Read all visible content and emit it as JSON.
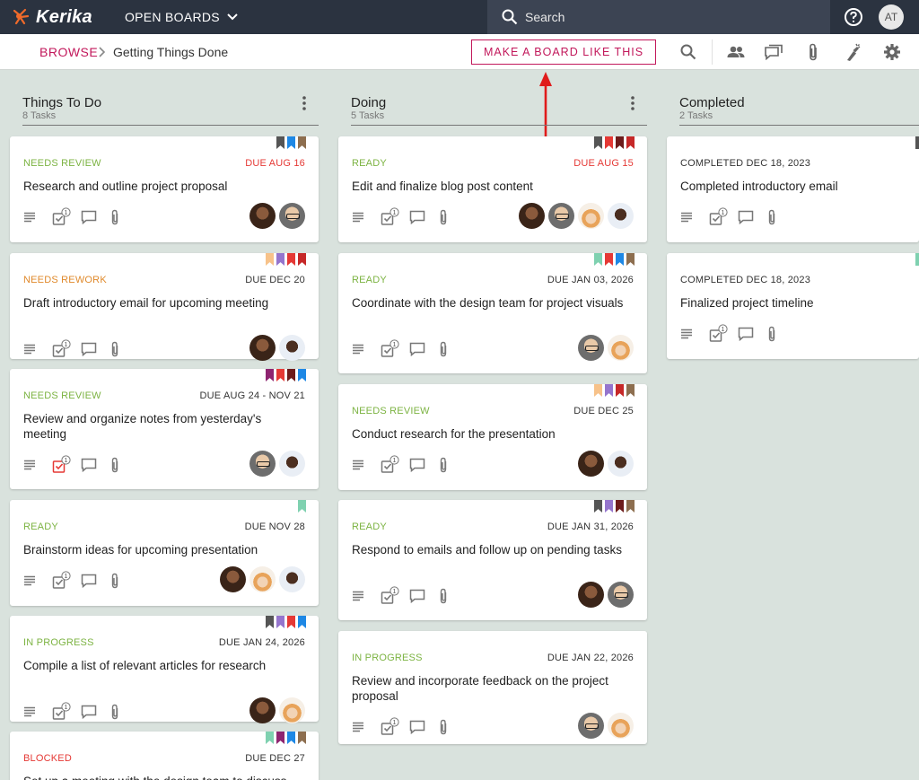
{
  "topbar": {
    "logo_text": "Kerika",
    "open_boards_label": "OPEN BOARDS",
    "search_placeholder": "Search",
    "user_initials": "AT"
  },
  "subbar": {
    "breadcrumb_root": "BROWSE",
    "breadcrumb_current": "Getting Things Done",
    "make_board_label": "MAKE A BOARD LIKE THIS"
  },
  "colors": {
    "topbar_bg": "#2b3340",
    "accent": "#c2185b",
    "board_bg": "#d9e2dd",
    "status_green": "#7cb342",
    "status_orange": "#e08a2c",
    "status_red": "#e53935",
    "due_red": "#e53935"
  },
  "columns": [
    {
      "title": "Things To Do",
      "count": "8 Tasks",
      "cards": [
        {
          "status": "NEEDS REVIEW",
          "status_color": "#7cb342",
          "due": "DUE AUG 16",
          "due_color": "#e53935",
          "title": "Research and outline project proposal",
          "flags": [
            "#555555",
            "#1e88e5",
            "#8d6e4f"
          ],
          "avatars": [
            "dark",
            "glasses"
          ],
          "check_red": false
        },
        {
          "status": "NEEDS REWORK",
          "status_color": "#e08a2c",
          "due": "DUE DEC 20",
          "due_color": "#333333",
          "title": "Draft introductory email for upcoming meeting",
          "flags": [
            "#f7c28a",
            "#9575cd",
            "#e53935",
            "#c62828"
          ],
          "avatars": [
            "dark",
            "woman"
          ],
          "check_red": false
        },
        {
          "status": "NEEDS REVIEW",
          "status_color": "#7cb342",
          "due": "DUE AUG 24 - NOV 21",
          "due_color": "#333333",
          "title": "Review and organize notes from yesterday's meeting",
          "flags": [
            "#8e2470",
            "#e53935",
            "#6d1b1b",
            "#1e88e5"
          ],
          "avatars": [
            "glasses",
            "woman"
          ],
          "check_red": true
        },
        {
          "status": "READY",
          "status_color": "#7cb342",
          "due": "DUE NOV 28",
          "due_color": "#333333",
          "title": "Brainstorm ideas for upcoming presentation",
          "flags": [
            "#7fd1b0"
          ],
          "avatars": [
            "dark",
            "hat",
            "woman"
          ],
          "check_red": false
        },
        {
          "status": "IN PROGRESS",
          "status_color": "#7cb342",
          "due": "DUE JAN 24, 2026",
          "due_color": "#333333",
          "title": "Compile a list of relevant articles for research",
          "flags": [
            "#555555",
            "#9575cd",
            "#e53935",
            "#1e88e5"
          ],
          "avatars": [
            "dark",
            "hat"
          ],
          "check_red": false
        },
        {
          "status": "BLOCKED",
          "status_color": "#e53935",
          "due": "DUE DEC 27",
          "due_color": "#333333",
          "title": "Set up a meeting with the design team to discuss",
          "flags": [
            "#7fd1b0",
            "#8e2470",
            "#1e88e5",
            "#8d6e4f"
          ],
          "avatars": [],
          "check_red": false
        }
      ]
    },
    {
      "title": "Doing",
      "count": "5 Tasks",
      "cards": [
        {
          "status": "READY",
          "status_color": "#7cb342",
          "due": "DUE AUG 15",
          "due_color": "#e53935",
          "title": "Edit and finalize blog post content",
          "flags": [
            "#555555",
            "#e53935",
            "#6d1b1b",
            "#c62828"
          ],
          "avatars": [
            "dark",
            "glasses",
            "hat",
            "woman"
          ],
          "check_red": false
        },
        {
          "status": "READY",
          "status_color": "#7cb342",
          "due": "DUE JAN 03, 2026",
          "due_color": "#333333",
          "title": "Coordinate with the design team for project visuals",
          "flags": [
            "#7fd1b0",
            "#e53935",
            "#1e88e5",
            "#8d6e4f"
          ],
          "avatars": [
            "glasses",
            "hat"
          ],
          "check_red": false
        },
        {
          "status": "NEEDS REVIEW",
          "status_color": "#7cb342",
          "due": "DUE DEC 25",
          "due_color": "#333333",
          "title": "Conduct research for the presentation",
          "flags": [
            "#f7c28a",
            "#9575cd",
            "#c62828",
            "#8d6e4f"
          ],
          "avatars": [
            "dark",
            "woman"
          ],
          "check_red": false
        },
        {
          "status": "READY",
          "status_color": "#7cb342",
          "due": "DUE JAN 31, 2026",
          "due_color": "#333333",
          "title": "Respond to emails and follow up on pending tasks",
          "flags": [
            "#555555",
            "#9575cd",
            "#6d1b1b",
            "#8d6e4f"
          ],
          "avatars": [
            "dark",
            "glasses"
          ],
          "check_red": false
        },
        {
          "status": "IN PROGRESS",
          "status_color": "#7cb342",
          "due": "DUE JAN 22, 2026",
          "due_color": "#333333",
          "title": "Review and incorporate feedback on the project proposal",
          "flags": [],
          "avatars": [
            "glasses",
            "hat"
          ],
          "check_red": false
        }
      ]
    },
    {
      "title": "Completed",
      "count": "2 Tasks",
      "cards": [
        {
          "status": "COMPLETED DEC 18, 2023",
          "status_color": "#333333",
          "due": "",
          "due_color": "#333333",
          "title": "Completed introductory email",
          "flags": [],
          "edge_flag": "#555555",
          "avatars": [],
          "check_red": false
        },
        {
          "status": "COMPLETED DEC 18, 2023",
          "status_color": "#333333",
          "due": "",
          "due_color": "#333333",
          "title": "Finalized project timeline",
          "flags": [],
          "edge_flag": "#7fd1b0",
          "avatars": [],
          "check_red": false
        }
      ]
    }
  ]
}
